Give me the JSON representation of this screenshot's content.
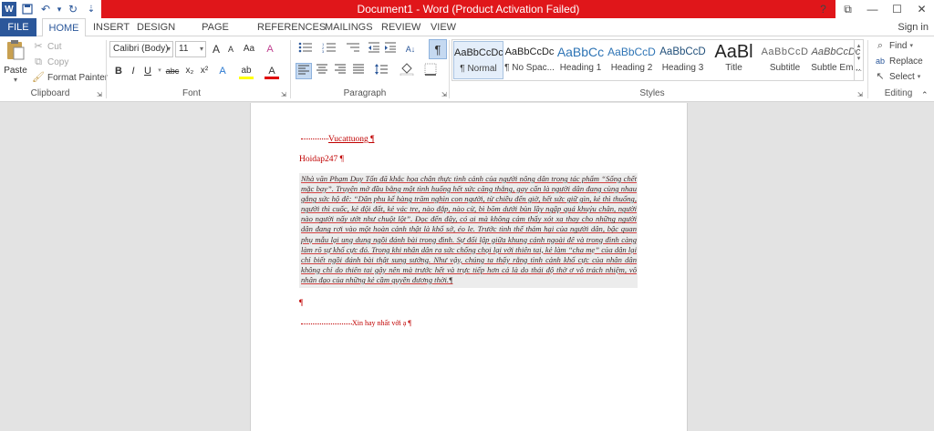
{
  "window": {
    "title": "Document1 - Word (Product Activation Failed)",
    "help": "?",
    "restore": "⧉",
    "minimize": "—",
    "maximize": "☐",
    "close": "✕"
  },
  "qat": {
    "word": "W",
    "save": "💾",
    "undo": "↶",
    "undo_dropdown": "▾",
    "redo": "↻",
    "customize": "⇣"
  },
  "tabs": [
    "FILE",
    "HOME",
    "INSERT",
    "DESIGN",
    "PAGE LAYOUT",
    "REFERENCES",
    "MAILINGS",
    "REVIEW",
    "VIEW"
  ],
  "signin": "Sign in",
  "clipboard": {
    "paste": "Paste",
    "cut": "Cut",
    "copy": "Copy",
    "format_painter": "Format Painter",
    "label": "Clipboard"
  },
  "font": {
    "family": "Calibri (Body)",
    "size": "11",
    "grow": "A",
    "shrink": "A",
    "case": "Aa",
    "clear": "A",
    "bold": "B",
    "italic": "I",
    "underline": "U",
    "strike": "abc",
    "sub": "x₂",
    "sup": "x²",
    "effects": "A",
    "highlight": "ab",
    "color": "A",
    "label": "Font"
  },
  "paragraph": {
    "label": "Paragraph",
    "pilcrow": "¶",
    "sort": "A↓"
  },
  "styles": {
    "label": "Styles",
    "items": [
      {
        "preview": "AaBbCcDc",
        "name": "¶ Normal"
      },
      {
        "preview": "AaBbCcDc",
        "name": "¶ No Spac..."
      },
      {
        "preview": "AaBbCc",
        "name": "Heading 1"
      },
      {
        "preview": "AaBbCcD",
        "name": "Heading 2"
      },
      {
        "preview": "AaBbCcD",
        "name": "Heading 3"
      },
      {
        "preview": "AaBl",
        "name": "Title"
      },
      {
        "preview": "AaBbCcD",
        "name": "Subtitle"
      },
      {
        "preview": "AaBbCcDc",
        "name": "Subtle Em..."
      }
    ]
  },
  "editing": {
    "find": "Find",
    "replace": "Replace",
    "select": "Select",
    "label": "Editing"
  },
  "document": {
    "line1": "Vucattuong ¶",
    "line2": "Hoidap247 ¶",
    "body": "Nhà văn Phạm Duy Tốn đã khắc họa chân thực tình cảnh của người nông dân trong tác phẩm “Sống chết mặc bay”. Truyện mở đầu bằng một tình huống hết sức căng thẳng, gay cấn là người dân đang cùng nhau gắng sức hộ đê: “Dân phu kể hàng trăm nghìn con người, từ chiều đến giờ, hết sức giữ gìn, kẻ thì thuổng, người thì cuốc, kẻ đội đất, kẻ vác tre, nào đắp, nào cừ, bì bõm dưới bùn lầy ngập quá khuỷu chân, người nào người nấy ướt như chuột lột”. Đọc đến đây, có ai mà không cảm thấy xót xa thay cho những người dân đang rơi vào một hoàn cảnh thật là khổ sở, éo le. Trước tình thế thảm hại của người dân, bậc quan phụ mẫu lại ung dung ngồi đánh bài trong đình. Sự đối lập giữa khung cảnh ngoài đê và trong đình càng làm rõ sự khổ cực đó. Trong khi nhân dân ra sức chống chọi lại với thiên tai, kẻ làm “cha mẹ” của dân lại chỉ biết ngồi đánh bài thật sung sướng. Như vậy, chúng ta thấy rằng tình cảnh khổ cực của nhân dân không chỉ do thiên tai gây nên mà trước hết và trực tiếp hơn cả là do thái độ thờ ơ vô trách nhiệm, vô nhân đạo của những kẻ cầm quyền đương thời.¶",
    "empty_para": "¶",
    "footer": "Xin hay nhất với ạ ¶"
  }
}
